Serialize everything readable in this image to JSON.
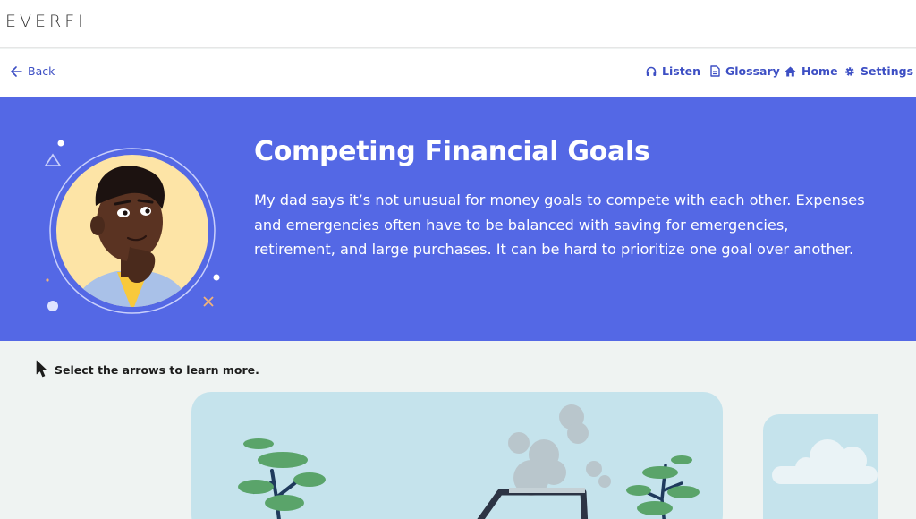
{
  "app": {
    "logo": "EVERFI"
  },
  "nav": {
    "back": "Back",
    "listen": "Listen",
    "glossary": "Glossary",
    "home": "Home",
    "settings": "Settings"
  },
  "hero": {
    "title": "Competing Financial Goals",
    "body": "My dad says it’s not unusual for money goals to compete with each other. Expenses and emergencies often have to be balanced with saving for emergencies, retirement, and large purchases. It can be hard to prioritize one goal over another."
  },
  "instruction": {
    "text": "Select the arrows to learn more."
  },
  "colors": {
    "accent": "#3d4fc4",
    "hero_bg": "#5468e5",
    "card_bg": "#c5e3ec",
    "page_bg": "#eff3f2"
  },
  "icons": {
    "back": "arrow-left-icon",
    "listen": "headphones-icon",
    "glossary": "document-icon",
    "home": "home-icon",
    "settings": "gear-icon",
    "pointer": "cursor-icon"
  }
}
